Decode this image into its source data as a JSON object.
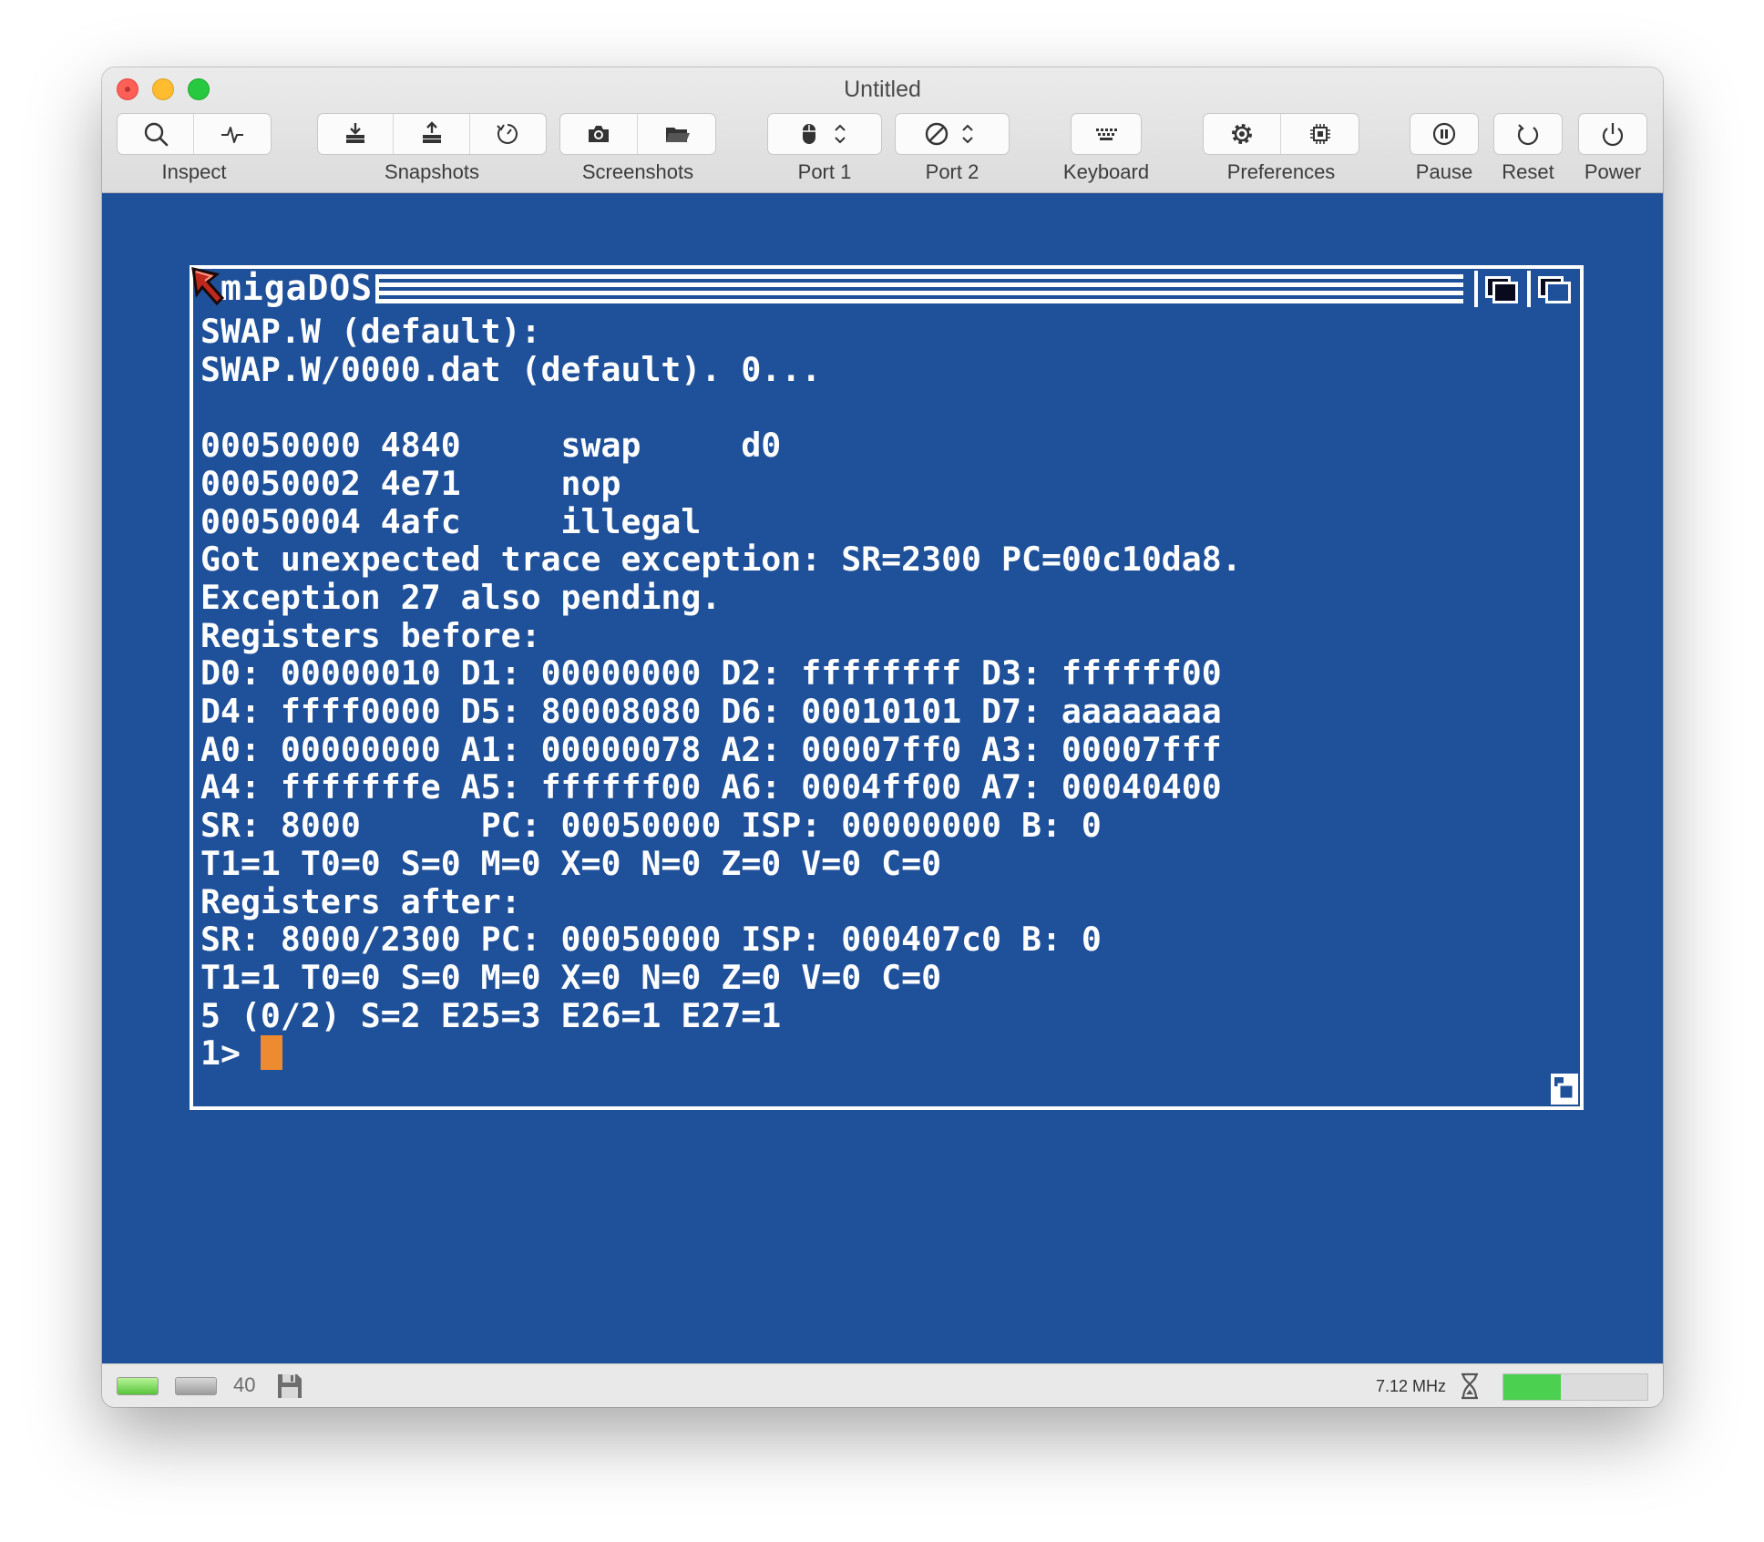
{
  "window": {
    "title": "Untitled"
  },
  "toolbar": {
    "inspect_label": "Inspect",
    "snapshots_label": "Snapshots",
    "screenshots_label": "Screenshots",
    "port1_label": "Port 1",
    "port2_label": "Port 2",
    "keyboard_label": "Keyboard",
    "preferences_label": "Preferences",
    "pause_label": "Pause",
    "reset_label": "Reset",
    "power_label": "Power"
  },
  "amiga_window": {
    "title": "AmigaDOS",
    "title_visible": "migaDOS",
    "lines": [
      "SWAP.W (default):",
      "SWAP.W/0000.dat (default). 0...",
      "",
      "00050000 4840     swap     d0",
      "00050002 4e71     nop",
      "00050004 4afc     illegal",
      "Got unexpected trace exception: SR=2300 PC=00c10da8.",
      "Exception 27 also pending.",
      "Registers before:",
      "D0: 00000010 D1: 00000000 D2: ffffffff D3: ffffff00",
      "D4: ffff0000 D5: 80008080 D6: 00010101 D7: aaaaaaaa",
      "A0: 00000000 A1: 00000078 A2: 00007ff0 A3: 00007fff",
      "A4: fffffffe A5: ffffff00 A6: 0004ff00 A7: 00040400",
      "SR: 8000      PC: 00050000 ISP: 00000000 B: 0",
      "T1=1 T0=0 S=0 M=0 X=0 N=0 Z=0 V=0 C=0",
      "Registers after:",
      "SR: 8000/2300 PC: 00050000 ISP: 000407c0 B: 0",
      "T1=1 T0=0 S=0 M=0 X=0 N=0 Z=0 V=0 C=0",
      "5 (0/2) S=2 E25=3 E26=1 E27=1"
    ],
    "prompt": "1> "
  },
  "statusbar": {
    "track": "40",
    "clock": "7.12 MHz",
    "speed_fraction": 0.4
  },
  "colors": {
    "amiga_blue": "#1f509a",
    "amiga_white": "#ffffff",
    "cursor_orange": "#ee8a2f",
    "speed_green": "#4cd050"
  },
  "icons": {
    "inspect": [
      "magnifier-icon",
      "activity-icon"
    ],
    "snapshots": [
      "snapshot-take-icon",
      "snapshot-restore-icon",
      "snapshot-browse-icon"
    ],
    "screenshots": [
      "camera-icon",
      "folder-icon"
    ],
    "port1": "mouse-icon",
    "port2": "none-icon",
    "keyboard": "keyboard-icon",
    "preferences": [
      "gear-icon",
      "chip-icon"
    ],
    "pause": "pause-icon",
    "reset": "reset-icon",
    "power": "power-icon"
  }
}
